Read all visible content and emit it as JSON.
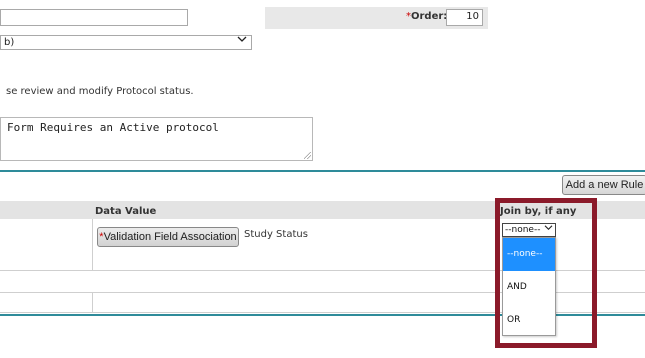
{
  "form": {
    "name_value": "",
    "order_label": "Order:",
    "order_required_mark": "*",
    "order_value": "10",
    "type_select_value": "b)",
    "description": "se review and modify Protocol status.",
    "message_text": "Form Requires an Active protocol"
  },
  "rules": {
    "add_rule_label": "Add a new Rule",
    "columns": {
      "data_value": "Data Value",
      "join_by": "Join by, if any"
    },
    "row": {
      "field_button_label": "Validation Field Association",
      "field_button_required_mark": "*",
      "field_value": "Study Status",
      "join_select_value": "--none--"
    },
    "join_options": [
      "--none--",
      "AND",
      "OR"
    ],
    "join_selected_index": 0
  },
  "colors": {
    "accent_line": "#2e8b9a",
    "highlight_box": "#8b1a2a",
    "dropdown_selected": "#1e90ff"
  }
}
